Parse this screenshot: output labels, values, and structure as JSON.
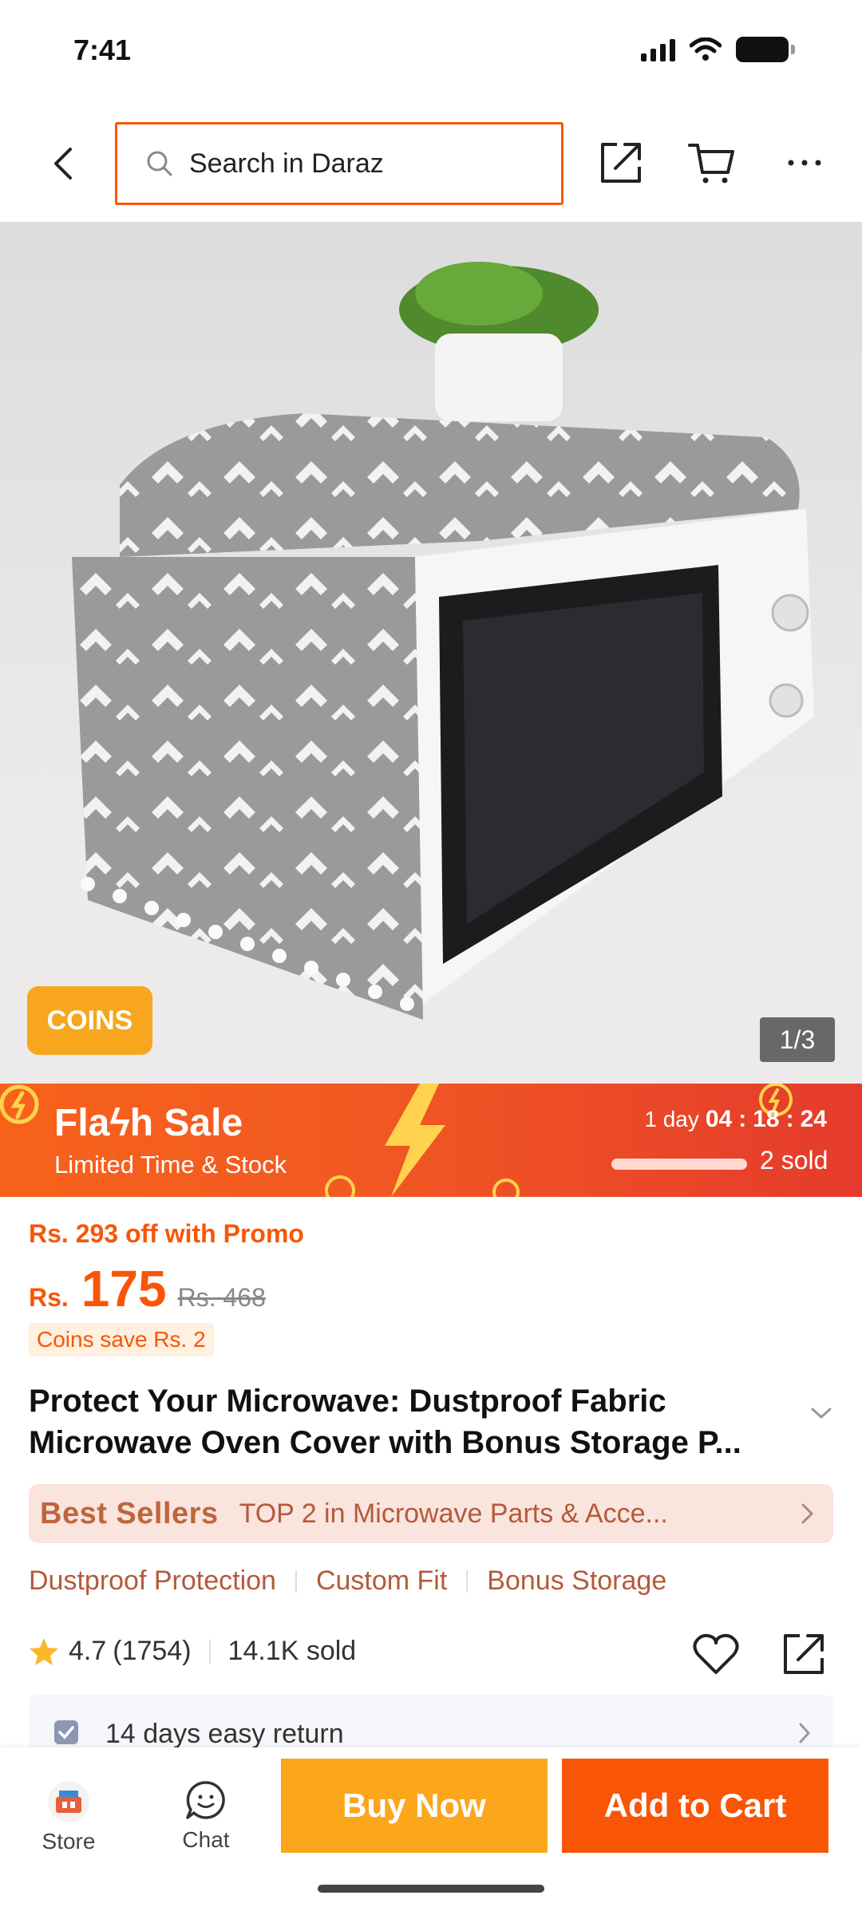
{
  "status_bar": {
    "time": "7:41"
  },
  "header": {
    "search_placeholder": "Search in Daraz"
  },
  "gallery": {
    "coins_badge": "COINS",
    "counter": "1/3"
  },
  "flash_sale": {
    "title": "Flaϟh Sale",
    "subtitle": "Limited Time & Stock",
    "timer_day": "1 day",
    "timer_hours": "04",
    "timer_minutes": "18",
    "timer_seconds": "24",
    "sold": "2 sold",
    "sold_progress_fraction": 1.0
  },
  "price": {
    "promo": "Rs. 293 off with Promo",
    "currency": "Rs.",
    "value": "175",
    "original": "Rs. 468",
    "coins_save": "Coins save Rs. 2"
  },
  "product": {
    "title": "Protect Your Microwave: Dustproof Fabric Microwave Oven Cover with Bonus Storage P..."
  },
  "best_sellers": {
    "logo": "Best Sellers",
    "text": "TOP 2 in Microwave Parts & Acce..."
  },
  "features": [
    "Dustproof Protection",
    "Custom Fit",
    "Bonus Storage"
  ],
  "rating": {
    "score": "4.7",
    "count": "(1754)",
    "sold": "14.1K sold"
  },
  "returns": {
    "text": "14 days easy return"
  },
  "bottom_bar": {
    "store_label": "Store",
    "chat_label": "Chat",
    "buy_now": "Buy Now",
    "add_to_cart": "Add to Cart"
  },
  "colors": {
    "accent": "#f85606",
    "buy_now": "#fba61b",
    "coins": "#f7a61d"
  }
}
